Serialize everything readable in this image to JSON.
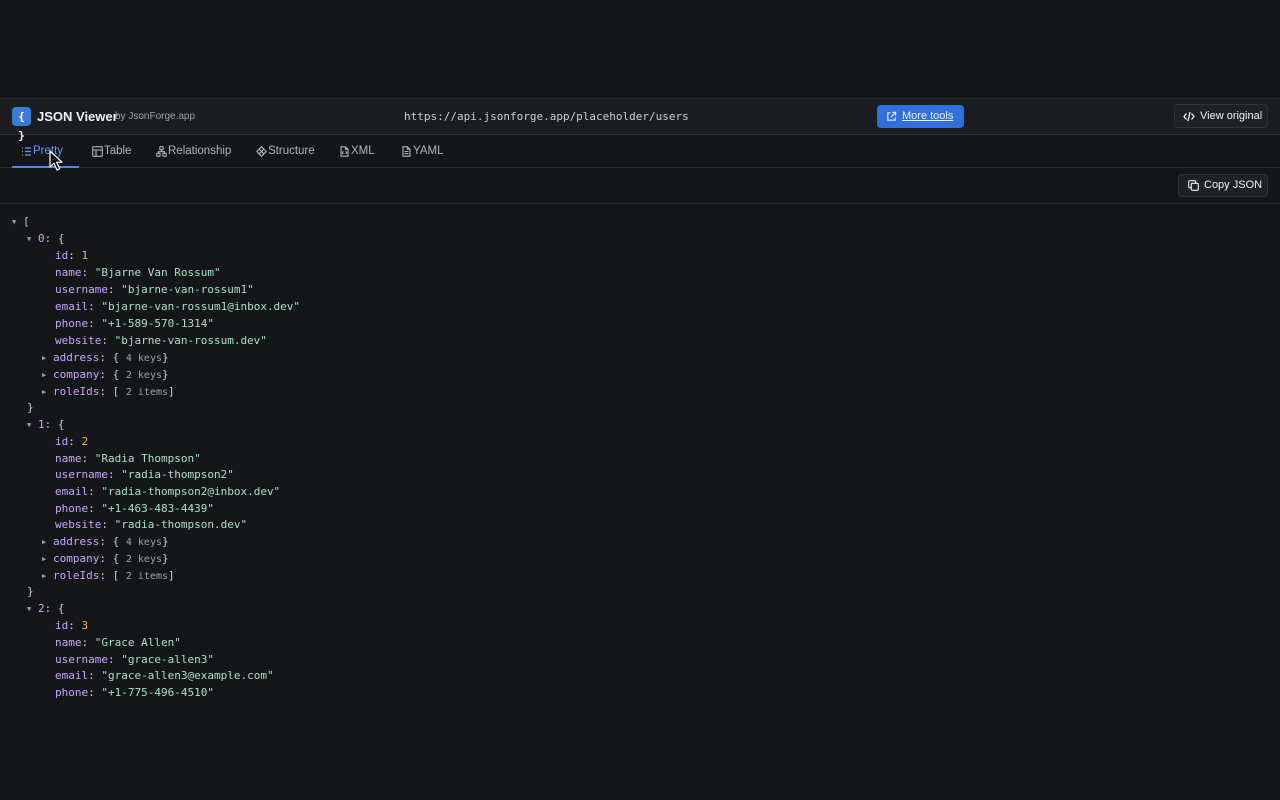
{
  "app": {
    "logo_glyph": "{ }",
    "title": "JSON Viewer",
    "by": "by JsonForge.app",
    "url": "https://api.jsonforge.app/placeholder/users",
    "more_tools": "More tools",
    "view_original": "View original",
    "copy_json": "Copy JSON"
  },
  "colors": {
    "accent": "#2f6fe0",
    "key": "#c8a6ff",
    "string": "#a5e1c5",
    "number": "#f0b45a"
  },
  "tabs": [
    {
      "label": "Pretty",
      "icon": "list-icon",
      "active": true
    },
    {
      "label": "Table",
      "icon": "table-icon",
      "active": false
    },
    {
      "label": "Relationship",
      "icon": "relationship-icon",
      "active": false
    },
    {
      "label": "Structure",
      "icon": "structure-icon",
      "active": false
    },
    {
      "label": "XML",
      "icon": "xml-file-icon",
      "active": false
    },
    {
      "label": "YAML",
      "icon": "yaml-file-icon",
      "active": false
    }
  ],
  "tree": {
    "items": [
      {
        "index": "0",
        "id": "1",
        "name": "\"Bjarne Van Rossum\"",
        "username": "\"bjarne-van-rossum1\"",
        "email": "\"bjarne-van-rossum1@inbox.dev\"",
        "phone": "\"+1-589-570-1314\"",
        "website": "\"bjarne-van-rossum.dev\"",
        "address": "4 keys",
        "company": "2 keys",
        "roleIds": "2 items"
      },
      {
        "index": "1",
        "id": "2",
        "name": "\"Radia Thompson\"",
        "username": "\"radia-thompson2\"",
        "email": "\"radia-thompson2@inbox.dev\"",
        "phone": "\"+1-463-483-4439\"",
        "website": "\"radia-thompson.dev\"",
        "address": "4 keys",
        "company": "2 keys",
        "roleIds": "2 items"
      },
      {
        "index": "2",
        "id": "3",
        "name": "\"Grace Allen\"",
        "username": "\"grace-allen3\"",
        "email": "\"grace-allen3@example.com\"",
        "phone": "\"+1-775-496-4510\""
      }
    ]
  }
}
